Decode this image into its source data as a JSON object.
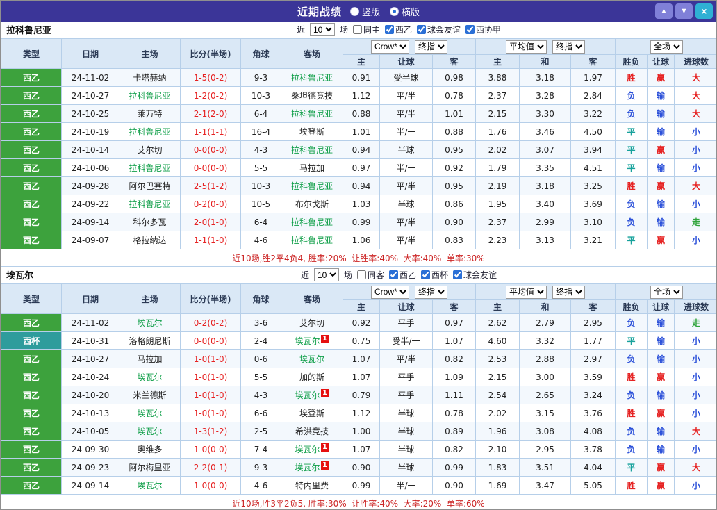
{
  "titlebar": {
    "title": "近期战绩",
    "layout_options": [
      {
        "label": "竖版",
        "selected": false
      },
      {
        "label": "横版",
        "selected": true
      }
    ],
    "up_icon": "▲",
    "down_icon": "▼",
    "close_icon": "×"
  },
  "table_headers": {
    "left": [
      "类型",
      "日期",
      "主场",
      "比分(半场)",
      "角球",
      "客场"
    ],
    "asian": [
      "主",
      "让球",
      "客"
    ],
    "euro": [
      "主",
      "和",
      "客"
    ],
    "right": [
      "胜负",
      "让球",
      "进球数"
    ]
  },
  "sections": [
    {
      "team": "拉科鲁尼亚",
      "filter": {
        "near_label": "近",
        "count": "10",
        "games_label": "场",
        "same_label": "同主",
        "leagues": [
          "西乙",
          "球会友谊",
          "西协甲"
        ]
      },
      "selects": {
        "crown": "Crow*",
        "final_a": "终指",
        "avg": "平均值",
        "final_b": "终指",
        "full": "全场"
      },
      "rows": [
        {
          "league": {
            "label": "西乙",
            "type": "green"
          },
          "date": "24-11-02",
          "home": {
            "name": "卡塔赫纳",
            "self": false
          },
          "score": "1-5(0-2)",
          "corners": "9-3",
          "away": {
            "name": "拉科鲁尼亚",
            "self": true
          },
          "asian": {
            "home": "0.91",
            "line": "受半球",
            "away": "0.98"
          },
          "euro": {
            "home": "3.88",
            "draw": "3.18",
            "away": "1.97"
          },
          "result": {
            "text": "胜",
            "cls": "red"
          },
          "handicap": {
            "text": "赢",
            "cls": "red"
          },
          "goals": {
            "text": "大",
            "cls": "red"
          }
        },
        {
          "league": {
            "label": "西乙",
            "type": "green"
          },
          "date": "24-10-27",
          "home": {
            "name": "拉科鲁尼亚",
            "self": true
          },
          "score": "1-2(0-2)",
          "corners": "10-3",
          "away": {
            "name": "桑坦德竞技",
            "self": false
          },
          "asian": {
            "home": "1.12",
            "line": "平/半",
            "away": "0.78"
          },
          "euro": {
            "home": "2.37",
            "draw": "3.28",
            "away": "2.84"
          },
          "result": {
            "text": "负",
            "cls": "blue"
          },
          "handicap": {
            "text": "输",
            "cls": "blue"
          },
          "goals": {
            "text": "大",
            "cls": "red"
          }
        },
        {
          "league": {
            "label": "西乙",
            "type": "green"
          },
          "date": "24-10-25",
          "home": {
            "name": "莱万特",
            "self": false
          },
          "score": "2-1(2-0)",
          "corners": "6-4",
          "away": {
            "name": "拉科鲁尼亚",
            "self": true
          },
          "asian": {
            "home": "0.88",
            "line": "平/半",
            "away": "1.01"
          },
          "euro": {
            "home": "2.15",
            "draw": "3.30",
            "away": "3.22"
          },
          "result": {
            "text": "负",
            "cls": "blue"
          },
          "handicap": {
            "text": "输",
            "cls": "blue"
          },
          "goals": {
            "text": "大",
            "cls": "red"
          }
        },
        {
          "league": {
            "label": "西乙",
            "type": "green"
          },
          "date": "24-10-19",
          "home": {
            "name": "拉科鲁尼亚",
            "self": true
          },
          "score": "1-1(1-1)",
          "corners": "16-4",
          "away": {
            "name": "埃登斯",
            "self": false
          },
          "asian": {
            "home": "1.01",
            "line": "半/一",
            "away": "0.88"
          },
          "euro": {
            "home": "1.76",
            "draw": "3.46",
            "away": "4.50"
          },
          "result": {
            "text": "平",
            "cls": "teal"
          },
          "handicap": {
            "text": "输",
            "cls": "blue"
          },
          "goals": {
            "text": "小",
            "cls": "blue"
          }
        },
        {
          "league": {
            "label": "西乙",
            "type": "green"
          },
          "date": "24-10-14",
          "home": {
            "name": "艾尔切",
            "self": false
          },
          "score": "0-0(0-0)",
          "corners": "4-3",
          "away": {
            "name": "拉科鲁尼亚",
            "self": true
          },
          "asian": {
            "home": "0.94",
            "line": "半球",
            "away": "0.95"
          },
          "euro": {
            "home": "2.02",
            "draw": "3.07",
            "away": "3.94"
          },
          "result": {
            "text": "平",
            "cls": "teal"
          },
          "handicap": {
            "text": "赢",
            "cls": "red"
          },
          "goals": {
            "text": "小",
            "cls": "blue"
          }
        },
        {
          "league": {
            "label": "西乙",
            "type": "green"
          },
          "date": "24-10-06",
          "home": {
            "name": "拉科鲁尼亚",
            "self": true
          },
          "score": "0-0(0-0)",
          "corners": "5-5",
          "away": {
            "name": "马拉加",
            "self": false
          },
          "asian": {
            "home": "0.97",
            "line": "半/一",
            "away": "0.92"
          },
          "euro": {
            "home": "1.79",
            "draw": "3.35",
            "away": "4.51"
          },
          "result": {
            "text": "平",
            "cls": "teal"
          },
          "handicap": {
            "text": "输",
            "cls": "blue"
          },
          "goals": {
            "text": "小",
            "cls": "blue"
          }
        },
        {
          "league": {
            "label": "西乙",
            "type": "green"
          },
          "date": "24-09-28",
          "home": {
            "name": "阿尔巴塞特",
            "self": false
          },
          "score": "2-5(1-2)",
          "corners": "10-3",
          "away": {
            "name": "拉科鲁尼亚",
            "self": true
          },
          "asian": {
            "home": "0.94",
            "line": "平/半",
            "away": "0.95"
          },
          "euro": {
            "home": "2.19",
            "draw": "3.18",
            "away": "3.25"
          },
          "result": {
            "text": "胜",
            "cls": "red"
          },
          "handicap": {
            "text": "赢",
            "cls": "red"
          },
          "goals": {
            "text": "大",
            "cls": "red"
          }
        },
        {
          "league": {
            "label": "西乙",
            "type": "green"
          },
          "date": "24-09-22",
          "home": {
            "name": "拉科鲁尼亚",
            "self": true
          },
          "score": "0-2(0-0)",
          "corners": "10-5",
          "away": {
            "name": "布尔戈斯",
            "self": false
          },
          "asian": {
            "home": "1.03",
            "line": "半球",
            "away": "0.86"
          },
          "euro": {
            "home": "1.95",
            "draw": "3.40",
            "away": "3.69"
          },
          "result": {
            "text": "负",
            "cls": "blue"
          },
          "handicap": {
            "text": "输",
            "cls": "blue"
          },
          "goals": {
            "text": "小",
            "cls": "blue"
          }
        },
        {
          "league": {
            "label": "西乙",
            "type": "green"
          },
          "date": "24-09-14",
          "home": {
            "name": "科尔多瓦",
            "self": false
          },
          "score": "2-0(1-0)",
          "corners": "6-4",
          "away": {
            "name": "拉科鲁尼亚",
            "self": true
          },
          "asian": {
            "home": "0.99",
            "line": "平/半",
            "away": "0.90"
          },
          "euro": {
            "home": "2.37",
            "draw": "2.99",
            "away": "3.10"
          },
          "result": {
            "text": "负",
            "cls": "blue"
          },
          "handicap": {
            "text": "输",
            "cls": "blue"
          },
          "goals": {
            "text": "走",
            "cls": "green"
          }
        },
        {
          "league": {
            "label": "西乙",
            "type": "green"
          },
          "date": "24-09-07",
          "home": {
            "name": "格拉纳达",
            "self": false
          },
          "score": "1-1(1-0)",
          "corners": "4-6",
          "away": {
            "name": "拉科鲁尼亚",
            "self": true
          },
          "asian": {
            "home": "1.06",
            "line": "平/半",
            "away": "0.83"
          },
          "euro": {
            "home": "2.23",
            "draw": "3.13",
            "away": "3.21"
          },
          "result": {
            "text": "平",
            "cls": "teal"
          },
          "handicap": {
            "text": "赢",
            "cls": "red"
          },
          "goals": {
            "text": "小",
            "cls": "blue"
          }
        }
      ],
      "summary": "近10场,胜2平4负4, 胜率:20%  让胜率:40%  大率:40%  单率:30%"
    },
    {
      "team": "埃瓦尔",
      "filter": {
        "near_label": "近",
        "count": "10",
        "games_label": "场",
        "same_label": "同客",
        "leagues": [
          "西乙",
          "西杯",
          "球会友谊"
        ]
      },
      "selects": {
        "crown": "Crow*",
        "final_a": "终指",
        "avg": "平均值",
        "final_b": "终指",
        "full": "全场"
      },
      "rows": [
        {
          "league": {
            "label": "西乙",
            "type": "green"
          },
          "date": "24-11-02",
          "home": {
            "name": "埃瓦尔",
            "self": true
          },
          "score": "0-2(0-2)",
          "corners": "3-6",
          "away": {
            "name": "艾尔切",
            "self": false
          },
          "asian": {
            "home": "0.92",
            "line": "平手",
            "away": "0.97"
          },
          "euro": {
            "home": "2.62",
            "draw": "2.79",
            "away": "2.95"
          },
          "result": {
            "text": "负",
            "cls": "blue"
          },
          "handicap": {
            "text": "输",
            "cls": "blue"
          },
          "goals": {
            "text": "走",
            "cls": "green"
          }
        },
        {
          "league": {
            "label": "西杯",
            "type": "teal"
          },
          "date": "24-10-31",
          "home": {
            "name": "洛格朗尼斯",
            "self": false
          },
          "score": "0-0(0-0)",
          "corners": "2-4",
          "away": {
            "name": "埃瓦尔",
            "self": true,
            "card": "1"
          },
          "asian": {
            "home": "0.75",
            "line": "受半/一",
            "away": "1.07"
          },
          "euro": {
            "home": "4.60",
            "draw": "3.32",
            "away": "1.77"
          },
          "result": {
            "text": "平",
            "cls": "teal"
          },
          "handicap": {
            "text": "输",
            "cls": "blue"
          },
          "goals": {
            "text": "小",
            "cls": "blue"
          }
        },
        {
          "league": {
            "label": "西乙",
            "type": "green"
          },
          "date": "24-10-27",
          "home": {
            "name": "马拉加",
            "self": false
          },
          "score": "1-0(1-0)",
          "corners": "0-6",
          "away": {
            "name": "埃瓦尔",
            "self": true
          },
          "asian": {
            "home": "1.07",
            "line": "平/半",
            "away": "0.82"
          },
          "euro": {
            "home": "2.53",
            "draw": "2.88",
            "away": "2.97"
          },
          "result": {
            "text": "负",
            "cls": "blue"
          },
          "handicap": {
            "text": "输",
            "cls": "blue"
          },
          "goals": {
            "text": "小",
            "cls": "blue"
          }
        },
        {
          "league": {
            "label": "西乙",
            "type": "green"
          },
          "date": "24-10-24",
          "home": {
            "name": "埃瓦尔",
            "self": true
          },
          "score": "1-0(1-0)",
          "corners": "5-5",
          "away": {
            "name": "加的斯",
            "self": false
          },
          "asian": {
            "home": "1.07",
            "line": "平手",
            "away": "1.09"
          },
          "euro": {
            "home": "2.15",
            "draw": "3.00",
            "away": "3.59"
          },
          "result": {
            "text": "胜",
            "cls": "red"
          },
          "handicap": {
            "text": "赢",
            "cls": "red"
          },
          "goals": {
            "text": "小",
            "cls": "blue"
          }
        },
        {
          "league": {
            "label": "西乙",
            "type": "green"
          },
          "date": "24-10-20",
          "home": {
            "name": "米兰德斯",
            "self": false
          },
          "score": "1-0(1-0)",
          "corners": "4-3",
          "away": {
            "name": "埃瓦尔",
            "self": true,
            "card": "1"
          },
          "asian": {
            "home": "0.79",
            "line": "平手",
            "away": "1.11"
          },
          "euro": {
            "home": "2.54",
            "draw": "2.65",
            "away": "3.24"
          },
          "result": {
            "text": "负",
            "cls": "blue"
          },
          "handicap": {
            "text": "输",
            "cls": "blue"
          },
          "goals": {
            "text": "小",
            "cls": "blue"
          }
        },
        {
          "league": {
            "label": "西乙",
            "type": "green"
          },
          "date": "24-10-13",
          "home": {
            "name": "埃瓦尔",
            "self": true
          },
          "score": "1-0(1-0)",
          "corners": "6-6",
          "away": {
            "name": "埃登斯",
            "self": false
          },
          "asian": {
            "home": "1.12",
            "line": "半球",
            "away": "0.78"
          },
          "euro": {
            "home": "2.02",
            "draw": "3.15",
            "away": "3.76"
          },
          "result": {
            "text": "胜",
            "cls": "red"
          },
          "handicap": {
            "text": "赢",
            "cls": "red"
          },
          "goals": {
            "text": "小",
            "cls": "blue"
          }
        },
        {
          "league": {
            "label": "西乙",
            "type": "green"
          },
          "date": "24-10-05",
          "home": {
            "name": "埃瓦尔",
            "self": true
          },
          "score": "1-3(1-2)",
          "corners": "2-5",
          "away": {
            "name": "希洪竞技",
            "self": false
          },
          "asian": {
            "home": "1.00",
            "line": "半球",
            "away": "0.89"
          },
          "euro": {
            "home": "1.96",
            "draw": "3.08",
            "away": "4.08"
          },
          "result": {
            "text": "负",
            "cls": "blue"
          },
          "handicap": {
            "text": "输",
            "cls": "blue"
          },
          "goals": {
            "text": "大",
            "cls": "red"
          }
        },
        {
          "league": {
            "label": "西乙",
            "type": "green"
          },
          "date": "24-09-30",
          "home": {
            "name": "奥维多",
            "self": false
          },
          "score": "1-0(0-0)",
          "corners": "7-4",
          "away": {
            "name": "埃瓦尔",
            "self": true,
            "card": "1"
          },
          "asian": {
            "home": "1.07",
            "line": "半球",
            "away": "0.82"
          },
          "euro": {
            "home": "2.10",
            "draw": "2.95",
            "away": "3.78"
          },
          "result": {
            "text": "负",
            "cls": "blue"
          },
          "handicap": {
            "text": "输",
            "cls": "blue"
          },
          "goals": {
            "text": "小",
            "cls": "blue"
          }
        },
        {
          "league": {
            "label": "西乙",
            "type": "green"
          },
          "date": "24-09-23",
          "home": {
            "name": "阿尔梅里亚",
            "self": false
          },
          "score": "2-2(0-1)",
          "corners": "9-3",
          "away": {
            "name": "埃瓦尔",
            "self": true,
            "card": "1"
          },
          "asian": {
            "home": "0.90",
            "line": "半球",
            "away": "0.99"
          },
          "euro": {
            "home": "1.83",
            "draw": "3.51",
            "away": "4.04"
          },
          "result": {
            "text": "平",
            "cls": "teal"
          },
          "handicap": {
            "text": "赢",
            "cls": "red"
          },
          "goals": {
            "text": "大",
            "cls": "red"
          }
        },
        {
          "league": {
            "label": "西乙",
            "type": "green"
          },
          "date": "24-09-14",
          "home": {
            "name": "埃瓦尔",
            "self": true
          },
          "score": "1-0(0-0)",
          "corners": "4-6",
          "away": {
            "name": "特内里费",
            "self": false
          },
          "asian": {
            "home": "0.99",
            "line": "半/一",
            "away": "0.90"
          },
          "euro": {
            "home": "1.69",
            "draw": "3.47",
            "away": "5.05"
          },
          "result": {
            "text": "胜",
            "cls": "red"
          },
          "handicap": {
            "text": "赢",
            "cls": "red"
          },
          "goals": {
            "text": "小",
            "cls": "blue"
          }
        }
      ],
      "summary": "近10场,胜3平2负5, 胜率:30%  让胜率:40%  大率:20%  单率:60%"
    }
  ]
}
